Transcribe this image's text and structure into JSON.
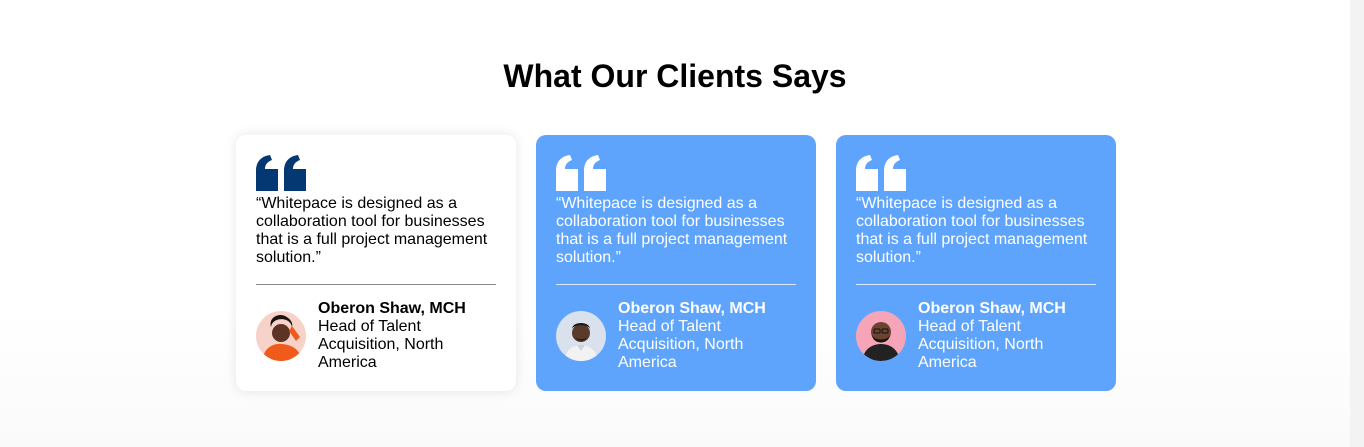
{
  "section": {
    "title": "What Our Clients Says"
  },
  "testimonials": [
    {
      "quote": "“Whitepace is designed as a collaboration tool for businesses that is a full project management solution.”",
      "name": "Oberon Shaw, MCH",
      "role": "Head of Talent Acquisition, North America",
      "theme": "light",
      "quote_icon_color": "#043873",
      "avatar_bg": "#f7d2c9",
      "avatar_accent": "#f05a1a"
    },
    {
      "quote": "“Whitepace is designed as a collaboration tool for businesses that is a full project management solution.”",
      "name": "Oberon Shaw, MCH",
      "role": "Head of Talent Acquisition, North America",
      "theme": "blue",
      "quote_icon_color": "#ffffff",
      "avatar_bg": "#d9e2ec",
      "avatar_accent": "#f2f2f2"
    },
    {
      "quote": "“Whitepace is designed as a collaboration tool for businesses that is a full project management solution.”",
      "name": "Oberon Shaw, MCH",
      "role": "Head of Talent Acquisition, North America",
      "theme": "blue",
      "quote_icon_color": "#ffffff",
      "avatar_bg": "#f6a5b8",
      "avatar_accent": "#222222"
    }
  ],
  "colors": {
    "card_blue": "#5ea4fd",
    "quote_dark": "#043873"
  }
}
